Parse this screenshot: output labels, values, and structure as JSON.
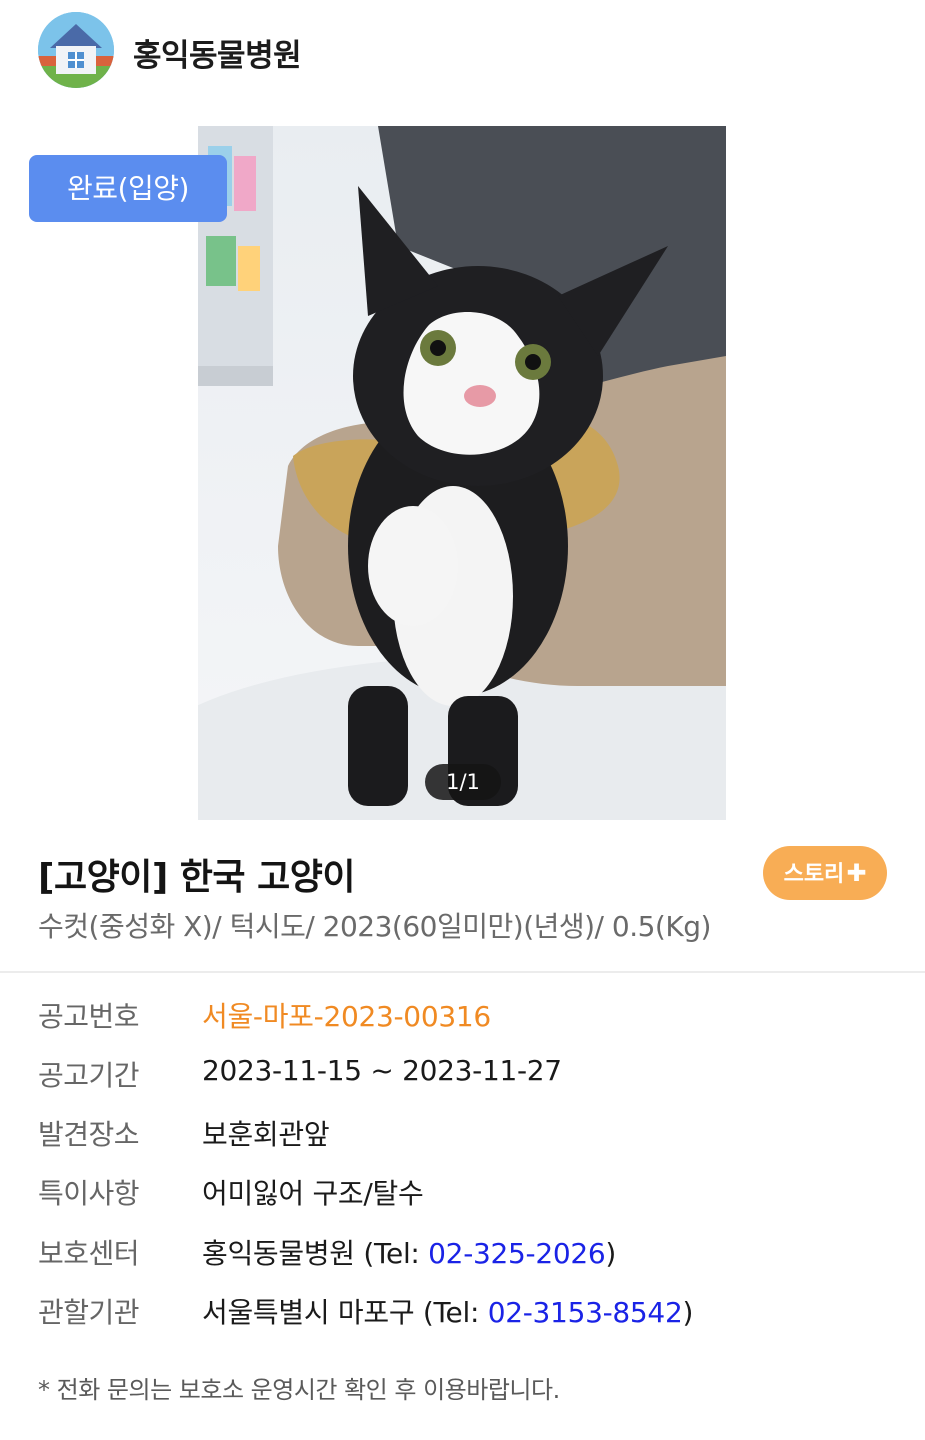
{
  "header": {
    "shelter_name": "홍익동물병원",
    "avatar_icon": "house-icon"
  },
  "photo": {
    "counter": "1/1",
    "status_badge": "완료(입양)"
  },
  "animal": {
    "title": "[고양이] 한국 고양이",
    "story_button": "스토리",
    "story_button_icon": "plus-icon",
    "subtitle": "수컷(중성화 X)/ 턱시도/ 2023(60일미만)(년생)/ 0.5(Kg)"
  },
  "details": [
    {
      "label": "공고번호",
      "value": "서울-마포-2023-00316"
    },
    {
      "label": "공고기간",
      "value": "2023-11-15 ~ 2023-11-27"
    },
    {
      "label": "발견장소",
      "value": "보훈회관앞"
    },
    {
      "label": "특이사항",
      "value": "어미잃어 구조/탈수"
    },
    {
      "label": "보호센터",
      "value_prefix": "홍익동물병원 (Tel: ",
      "phone": "02-325-2026",
      "value_suffix": ")"
    },
    {
      "label": "관할기관",
      "value_prefix": "서울특별시 마포구 (Tel: ",
      "phone": "02-3153-8542",
      "value_suffix": ")"
    }
  ],
  "note": "* 전화 문의는 보호소 운영시간 확인 후 이용바랍니다.",
  "colors": {
    "badge": "#5b8def",
    "story_button": "#f8ad55",
    "notice_number": "#f08a23",
    "phone_link": "#1a23e6"
  }
}
